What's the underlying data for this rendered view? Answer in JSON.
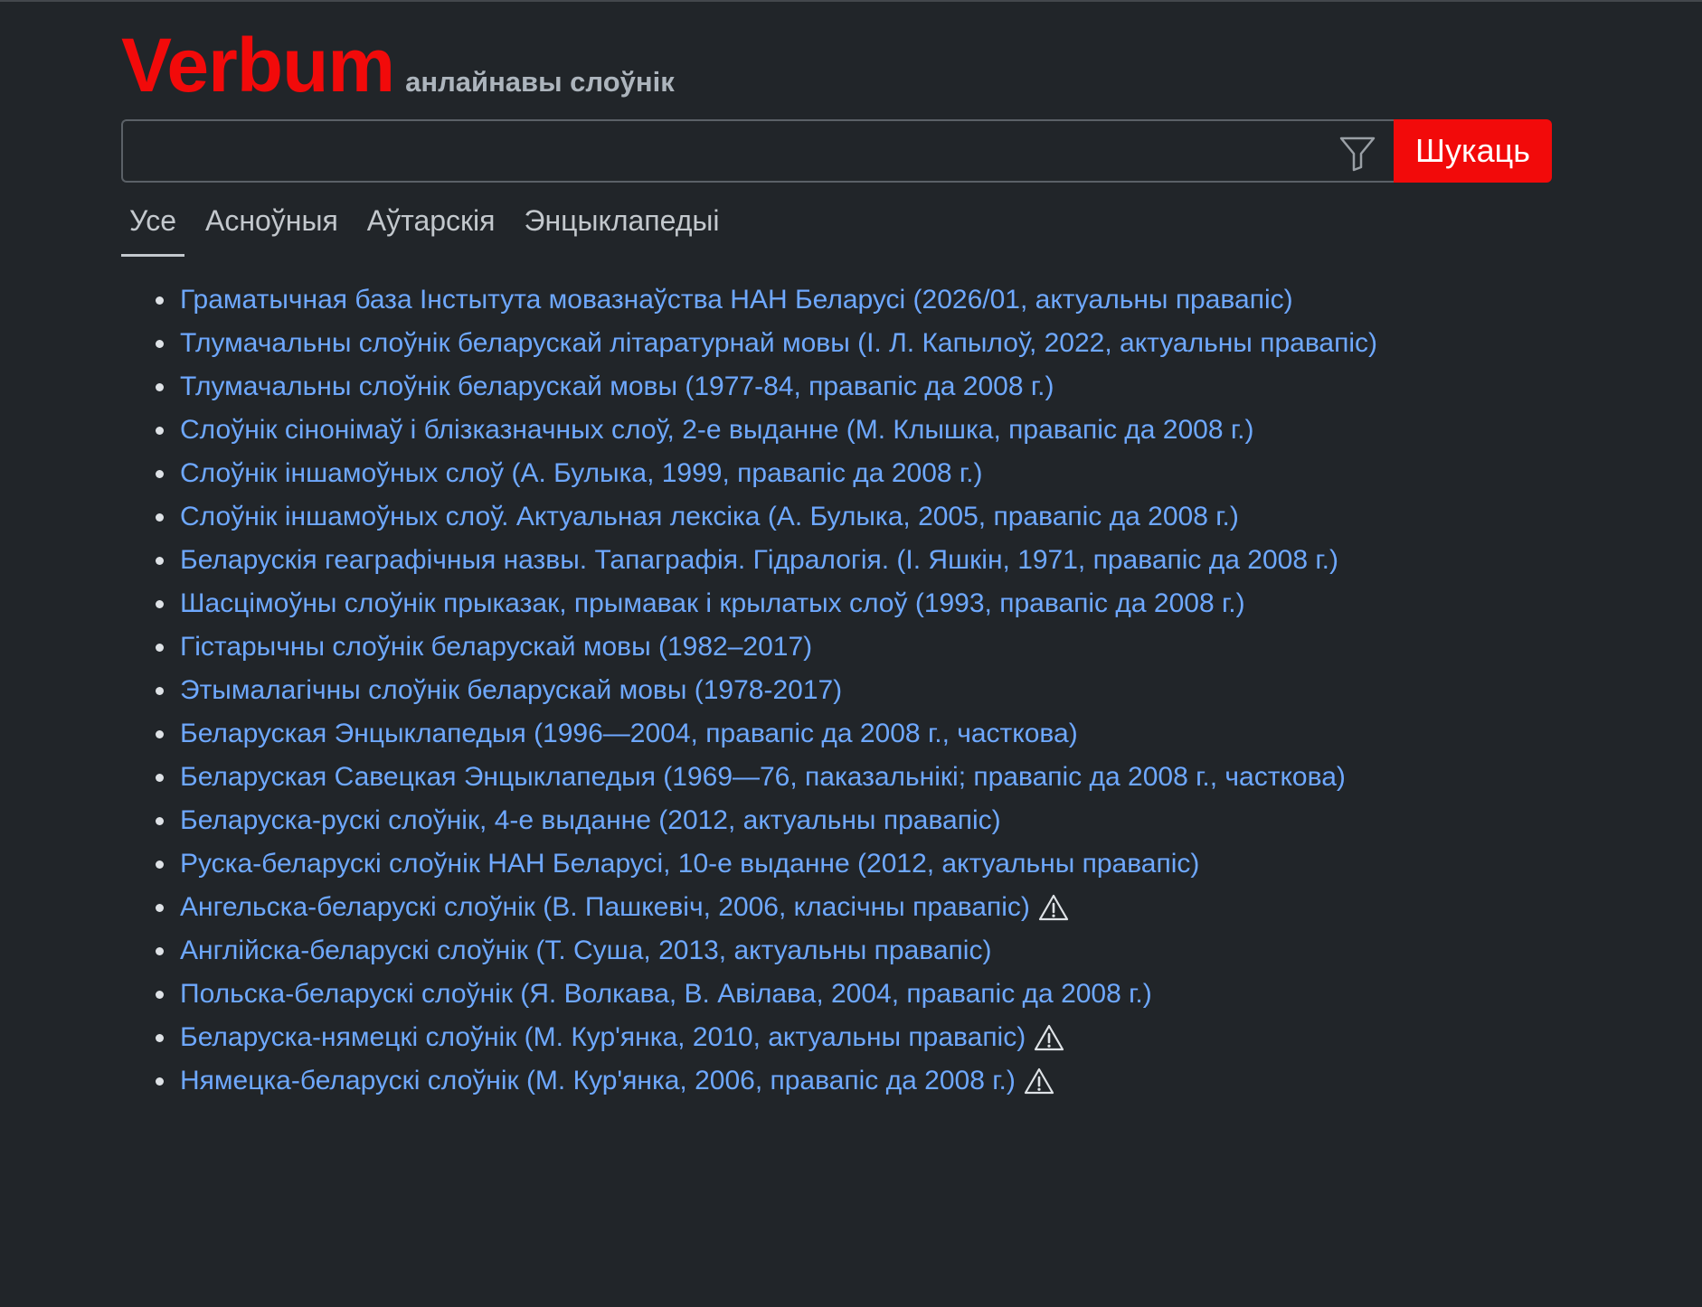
{
  "header": {
    "logo": "Verbum",
    "tagline": "анлайнавы слоўнік"
  },
  "search": {
    "value": "",
    "placeholder": "",
    "button_label": "Шукаць",
    "filter_icon": "filter-icon"
  },
  "tabs": [
    {
      "label": "Усе",
      "active": true
    },
    {
      "label": "Асноўныя",
      "active": false
    },
    {
      "label": "Аўтарскія",
      "active": false
    },
    {
      "label": "Энцыклапедыі",
      "active": false
    }
  ],
  "sources": [
    {
      "title": "Граматычная база Інстытута мовазнаўства НАН Беларусі (2026/01, актуальны правапіс)",
      "warning": false
    },
    {
      "title": "Тлумачальны слоўнік беларускай літаратурнай мовы (І. Л. Капылоў, 2022, актуальны правапіс)",
      "warning": false
    },
    {
      "title": "Тлумачальны слоўнік беларускай мовы (1977-84, правапіс да 2008 г.)",
      "warning": false
    },
    {
      "title": "Слоўнік сінонімаў і блізказначных слоў, 2-е выданне (М. Клышка, правапіс да 2008 г.)",
      "warning": false
    },
    {
      "title": "Слоўнік іншамоўных слоў (А. Булыка, 1999, правапіс да 2008 г.)",
      "warning": false
    },
    {
      "title": "Слоўнік іншамоўных слоў. Актуальная лексіка (А. Булыка, 2005, правапіс да 2008 г.)",
      "warning": false
    },
    {
      "title": "Беларускія геаграфічныя назвы. Тапаграфія. Гідралогія. (І. Яшкін, 1971, правапіс да 2008 г.)",
      "warning": false
    },
    {
      "title": "Шасцімоўны слоўнік прыказак, прымавак і крылатых слоў (1993, правапіс да 2008 г.)",
      "warning": false
    },
    {
      "title": "Гістарычны слоўнік беларускай мовы (1982–2017)",
      "warning": false
    },
    {
      "title": "Этымалагічны слоўнік беларускай мовы (1978-2017)",
      "warning": false
    },
    {
      "title": "Беларуская Энцыклапедыя (1996—2004, правапіс да 2008 г., часткова)",
      "warning": false
    },
    {
      "title": "Беларуская Савецкая Энцыклапедыя (1969—76, паказальнікі; правапіс да 2008 г., часткова)",
      "warning": false
    },
    {
      "title": "Беларуска-рускі слоўнік, 4-е выданне (2012, актуальны правапіс)",
      "warning": false
    },
    {
      "title": "Руска-беларускі слоўнік НАН Беларусі, 10-е выданне (2012, актуальны правапіс)",
      "warning": false
    },
    {
      "title": "Ангельска-беларускі слоўнік (В. Пашкевіч, 2006, класічны правапіс)",
      "warning": true
    },
    {
      "title": "Англійска-беларускі слоўнік (Т. Суша, 2013, актуальны правапіс)",
      "warning": false
    },
    {
      "title": "Польска-беларускі слоўнік (Я. Волкава, В. Авілава, 2004, правапіс да 2008 г.)",
      "warning": false
    },
    {
      "title": "Беларуска-нямецкі слоўнік (М. Кур'янка, 2010, актуальны правапіс)",
      "warning": true
    },
    {
      "title": "Нямецка-беларускі слоўнік (М. Кур'янка, 2006, правапіс да 2008 г.)",
      "warning": true
    }
  ],
  "colors": {
    "background": "#212529",
    "brand_red": "#f20a0a",
    "link": "#6ea8fe",
    "text": "#dee2e6"
  }
}
